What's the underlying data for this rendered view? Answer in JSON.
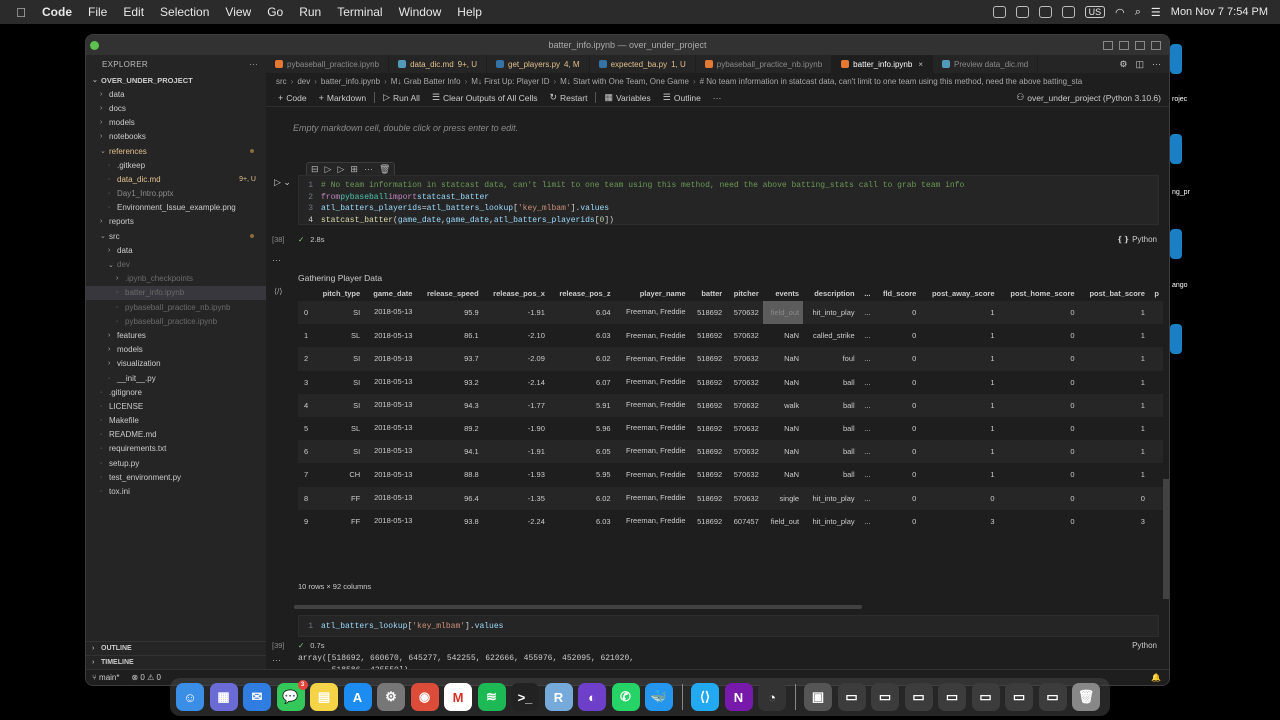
{
  "menubar": {
    "app": "Code",
    "items": [
      "File",
      "Edit",
      "Selection",
      "View",
      "Go",
      "Run",
      "Terminal",
      "Window",
      "Help"
    ],
    "input_source": "US",
    "clock": "Mon Nov 7  7:54 PM"
  },
  "window": {
    "title": "batter_info.ipynb — over_under_project"
  },
  "sidebar": {
    "header": "EXPLORER",
    "project": "OVER_UNDER_PROJECT",
    "items": [
      {
        "label": "data",
        "indent": 1,
        "folder": "closed"
      },
      {
        "label": "docs",
        "indent": 1,
        "folder": "closed"
      },
      {
        "label": "models",
        "indent": 1,
        "folder": "closed"
      },
      {
        "label": "notebooks",
        "indent": 1,
        "folder": "closed"
      },
      {
        "label": "references",
        "indent": 1,
        "folder": "open",
        "status": "mod",
        "dot": true
      },
      {
        "label": ".gitkeep",
        "indent": 2
      },
      {
        "label": "data_dic.md",
        "indent": 2,
        "status": "mod",
        "badge": "9+, U"
      },
      {
        "label": "Day1_Intro.pptx",
        "indent": 2,
        "status": "dim"
      },
      {
        "label": "Environment_Issue_example.png",
        "indent": 2
      },
      {
        "label": "reports",
        "indent": 1,
        "folder": "closed"
      },
      {
        "label": "src",
        "indent": 1,
        "folder": "open",
        "dot": true
      },
      {
        "label": "data",
        "indent": 2,
        "folder": "closed"
      },
      {
        "label": "dev",
        "indent": 2,
        "folder": "open",
        "status": "ign"
      },
      {
        "label": ".ipynb_checkpoints",
        "indent": 3,
        "folder": "closed",
        "status": "ign"
      },
      {
        "label": "batter_info.ipynb",
        "indent": 3,
        "status": "ign",
        "active": true
      },
      {
        "label": "pybaseball_practice_nb.ipynb",
        "indent": 3,
        "status": "ign"
      },
      {
        "label": "pybaseball_practice.ipynb",
        "indent": 3,
        "status": "ign"
      },
      {
        "label": "features",
        "indent": 2,
        "folder": "closed"
      },
      {
        "label": "models",
        "indent": 2,
        "folder": "closed"
      },
      {
        "label": "visualization",
        "indent": 2,
        "folder": "closed"
      },
      {
        "label": "__init__.py",
        "indent": 2
      },
      {
        "label": ".gitignore",
        "indent": 1
      },
      {
        "label": "LICENSE",
        "indent": 1
      },
      {
        "label": "Makefile",
        "indent": 1
      },
      {
        "label": "README.md",
        "indent": 1
      },
      {
        "label": "requirements.txt",
        "indent": 1
      },
      {
        "label": "setup.py",
        "indent": 1
      },
      {
        "label": "test_environment.py",
        "indent": 1
      },
      {
        "label": "tox.ini",
        "indent": 1
      }
    ],
    "outline": "OUTLINE",
    "timeline": "TIMELINE"
  },
  "tabs": [
    {
      "label": "pybaseball_practice.ipynb",
      "color": "#e37933",
      "status": "dim"
    },
    {
      "label": "data_dic.md",
      "suffix": "9+, U",
      "color": "#519aba",
      "status": "mod"
    },
    {
      "label": "get_players.py",
      "suffix": "4, M",
      "color": "#3572a5",
      "status": "mod"
    },
    {
      "label": "expected_ba.py",
      "suffix": "1, U",
      "color": "#3572a5",
      "status": "mod"
    },
    {
      "label": "pybaseball_practice_nb.ipynb",
      "color": "#e37933",
      "status": "dim"
    },
    {
      "label": "batter_info.ipynb",
      "color": "#e37933",
      "status": "dim",
      "active": true,
      "close": "×"
    },
    {
      "label": "Preview data_dic.md",
      "color": "#519aba",
      "status": "normal"
    }
  ],
  "breadcrumb": [
    "src",
    "dev",
    "batter_info.ipynb",
    "M↓ Grab Batter Info",
    "M↓ First Up: Player ID",
    "M↓ Start with One Team, One Game",
    "# No team information in statcast data, can't limit to one team using this method, need the above batting_sta"
  ],
  "toolbar": {
    "code": "Code",
    "markdown": "Markdown",
    "run_all": "Run All",
    "clear": "Clear Outputs of All Cells",
    "restart": "Restart",
    "variables": "Variables",
    "outline": "Outline",
    "more": "···",
    "kernel": "over_under_project (Python 3.10.6)"
  },
  "notebook": {
    "empty_md": "Empty markdown cell, double click or press enter to edit.",
    "cell1": {
      "exec": "[38]",
      "time": "2.8s",
      "lang": "Python",
      "lines": [
        [
          {
            "t": "# No team information in statcast data, can't limit to one team using this method, need the above batting_stats call to grab team info",
            "c": "com"
          }
        ],
        [
          {
            "t": "from ",
            "c": "kw"
          },
          {
            "t": "pybaseball ",
            "c": "mod"
          },
          {
            "t": "import ",
            "c": "kw"
          },
          {
            "t": "statcast_batter",
            "c": "var"
          }
        ],
        [
          {
            "t": "atl_batters_playerids",
            "c": "var"
          },
          {
            "t": " = ",
            "c": "pl"
          },
          {
            "t": "atl_batters_lookup",
            "c": "var"
          },
          {
            "t": "[",
            "c": "pl"
          },
          {
            "t": "'key_mlbam'",
            "c": "str"
          },
          {
            "t": "].",
            "c": "pl"
          },
          {
            "t": "values",
            "c": "var"
          }
        ],
        [
          {
            "t": "statcast_batter",
            "c": "fn"
          },
          {
            "t": "(",
            "c": "pl"
          },
          {
            "t": "game_date",
            "c": "var"
          },
          {
            "t": ", ",
            "c": "pl"
          },
          {
            "t": "game_date",
            "c": "var"
          },
          {
            "t": ", ",
            "c": "pl"
          },
          {
            "t": "atl_batters_playerids",
            "c": "var"
          },
          {
            "t": "[",
            "c": "pl"
          },
          {
            "t": "0",
            "c": "num"
          },
          {
            "t": "])",
            "c": "pl"
          }
        ]
      ],
      "output_text": "Gathering Player Data"
    },
    "dataframe": {
      "columns": [
        "",
        "pitch_type",
        "game_date",
        "release_speed",
        "release_pos_x",
        "release_pos_z",
        "player_name",
        "batter",
        "pitcher",
        "events",
        "description",
        "...",
        "fld_score",
        "post_away_score",
        "post_home_score",
        "post_bat_score",
        "p"
      ],
      "rows": [
        [
          "0",
          "SI",
          "2018-05-13",
          "95.9",
          "-1.91",
          "6.04",
          "Freeman, Freddie",
          "518692",
          "570632",
          "field_out",
          "hit_into_play",
          "...",
          "0",
          "1",
          "0",
          "1",
          ""
        ],
        [
          "1",
          "SL",
          "2018-05-13",
          "86.1",
          "-2.10",
          "6.03",
          "Freeman, Freddie",
          "518692",
          "570632",
          "NaN",
          "called_strike",
          "...",
          "0",
          "1",
          "0",
          "1",
          ""
        ],
        [
          "2",
          "SI",
          "2018-05-13",
          "93.7",
          "-2.09",
          "6.02",
          "Freeman, Freddie",
          "518692",
          "570632",
          "NaN",
          "foul",
          "...",
          "0",
          "1",
          "0",
          "1",
          ""
        ],
        [
          "3",
          "SI",
          "2018-05-13",
          "93.2",
          "-2.14",
          "6.07",
          "Freeman, Freddie",
          "518692",
          "570632",
          "NaN",
          "ball",
          "...",
          "0",
          "1",
          "0",
          "1",
          ""
        ],
        [
          "4",
          "SI",
          "2018-05-13",
          "94.3",
          "-1.77",
          "5.91",
          "Freeman, Freddie",
          "518692",
          "570632",
          "walk",
          "ball",
          "...",
          "0",
          "1",
          "0",
          "1",
          ""
        ],
        [
          "5",
          "SL",
          "2018-05-13",
          "89.2",
          "-1.90",
          "5.96",
          "Freeman, Freddie",
          "518692",
          "570632",
          "NaN",
          "ball",
          "...",
          "0",
          "1",
          "0",
          "1",
          ""
        ],
        [
          "6",
          "SI",
          "2018-05-13",
          "94.1",
          "-1.91",
          "6.05",
          "Freeman, Freddie",
          "518692",
          "570632",
          "NaN",
          "ball",
          "...",
          "0",
          "1",
          "0",
          "1",
          ""
        ],
        [
          "7",
          "CH",
          "2018-05-13",
          "88.8",
          "-1.93",
          "5.95",
          "Freeman, Freddie",
          "518692",
          "570632",
          "NaN",
          "ball",
          "...",
          "0",
          "1",
          "0",
          "1",
          ""
        ],
        [
          "8",
          "FF",
          "2018-05-13",
          "96.4",
          "-1.35",
          "6.02",
          "Freeman, Freddie",
          "518692",
          "570632",
          "single",
          "hit_into_play",
          "...",
          "0",
          "0",
          "0",
          "0",
          ""
        ],
        [
          "9",
          "FF",
          "2018-05-13",
          "93.8",
          "-2.24",
          "6.03",
          "Freeman, Freddie",
          "518692",
          "607457",
          "field_out",
          "hit_into_play",
          "...",
          "0",
          "3",
          "0",
          "3",
          ""
        ]
      ],
      "footer": "10 rows × 92 columns"
    },
    "cell2": {
      "exec": "[39]",
      "time": "0.7s",
      "lang": "Python",
      "lines": [
        [
          {
            "t": "atl_batters_lookup",
            "c": "var"
          },
          {
            "t": "[",
            "c": "pl"
          },
          {
            "t": "'key_mlbam'",
            "c": "str"
          },
          {
            "t": "].",
            "c": "pl"
          },
          {
            "t": "values",
            "c": "var"
          }
        ]
      ],
      "output": "array([518692, 660670, 645277, 542255, 622666, 455976, 452095, 621020,\n       518586, 435559])"
    },
    "cell3_line": "1"
  },
  "statusbar": {
    "branch": "main*",
    "problems": "⊗ 0 ⚠ 0"
  },
  "dock": [
    {
      "name": "finder",
      "color": "#3a8ee6",
      "glyph": "☺"
    },
    {
      "name": "launchpad",
      "color": "#6b6bd6",
      "glyph": "▦"
    },
    {
      "name": "mail",
      "color": "#2f7de1",
      "glyph": "✉"
    },
    {
      "name": "messages",
      "color": "#34c759",
      "glyph": "💬",
      "badge": "3"
    },
    {
      "name": "notes",
      "color": "#f5d547",
      "glyph": "▤"
    },
    {
      "name": "app-store",
      "color": "#1d8cf0",
      "glyph": "A"
    },
    {
      "name": "system-settings",
      "color": "#777777",
      "glyph": "⚙"
    },
    {
      "name": "chrome",
      "color": "#dd4b39",
      "glyph": "◉"
    },
    {
      "name": "gmail",
      "color": "#ffffff",
      "glyph": "M"
    },
    {
      "name": "spotify",
      "color": "#1db954",
      "glyph": "≋"
    },
    {
      "name": "terminal",
      "color": "#222222",
      "glyph": ">_"
    },
    {
      "name": "r-studio",
      "color": "#75aadb",
      "glyph": "R"
    },
    {
      "name": "github",
      "color": "#6e40c9",
      "glyph": "◐"
    },
    {
      "name": "whatsapp",
      "color": "#25d366",
      "glyph": "✆"
    },
    {
      "name": "docker",
      "color": "#2496ed",
      "glyph": "🐳"
    },
    {
      "name": "vscode",
      "color": "#23a9f2",
      "glyph": "⟨⟩"
    },
    {
      "name": "onenote",
      "color": "#7719aa",
      "glyph": "N"
    },
    {
      "name": "activity-monitor",
      "color": "#333333",
      "glyph": "◔"
    },
    {
      "name": "preview",
      "color": "#555555",
      "glyph": "▣"
    },
    {
      "name": "window-1",
      "color": "#3c3c3c",
      "glyph": "▭"
    },
    {
      "name": "window-2",
      "color": "#3c3c3c",
      "glyph": "▭"
    },
    {
      "name": "window-3",
      "color": "#3c3c3c",
      "glyph": "▭"
    },
    {
      "name": "window-4",
      "color": "#3c3c3c",
      "glyph": "▭"
    },
    {
      "name": "window-5",
      "color": "#3c3c3c",
      "glyph": "▭"
    },
    {
      "name": "window-6",
      "color": "#3c3c3c",
      "glyph": "▭"
    },
    {
      "name": "window-7",
      "color": "#3c3c3c",
      "glyph": "▭"
    },
    {
      "name": "trash",
      "color": "#888888",
      "glyph": "🗑"
    }
  ],
  "desktop": [
    "rojec",
    "ng_pr",
    "ango"
  ]
}
